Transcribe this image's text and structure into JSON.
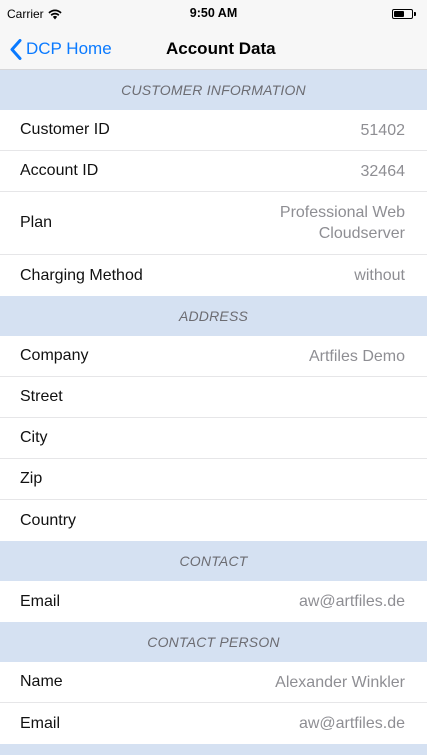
{
  "status_bar": {
    "carrier": "Carrier",
    "time": "9:50 AM",
    "battery_level": 0.6
  },
  "nav": {
    "back_label": "DCP Home",
    "title": "Account Data"
  },
  "sections": {
    "customer_information": {
      "header": "CUSTOMER INFORMATION",
      "rows": [
        {
          "label": "Customer ID",
          "value": "51402"
        },
        {
          "label": "Account ID",
          "value": "32464"
        },
        {
          "label": "Plan",
          "value_line1": "Professional Web",
          "value_line2": "Cloudserver"
        },
        {
          "label": "Charging Method",
          "value": "without"
        }
      ]
    },
    "address": {
      "header": "ADDRESS",
      "rows": [
        {
          "label": "Company",
          "value": "Artfiles Demo"
        },
        {
          "label": "Street",
          "value": ""
        },
        {
          "label": "City",
          "value": ""
        },
        {
          "label": "Zip",
          "value": ""
        },
        {
          "label": "Country",
          "value": ""
        }
      ]
    },
    "contact": {
      "header": "CONTACT",
      "rows": [
        {
          "label": "Email",
          "value": "aw@artfiles.de"
        }
      ]
    },
    "contact_person": {
      "header": "CONTACT PERSON",
      "rows": [
        {
          "label": "Name",
          "value": "Alexander Winkler"
        },
        {
          "label": "Email",
          "value": "aw@artfiles.de"
        }
      ]
    }
  },
  "colors": {
    "accent": "#0a7aff",
    "section_background": "#d5e1f2",
    "value_text": "#8e8e93"
  },
  "icons": {
    "back": "chevron-left-icon",
    "wifi": "wifi-icon",
    "battery": "battery-icon"
  }
}
